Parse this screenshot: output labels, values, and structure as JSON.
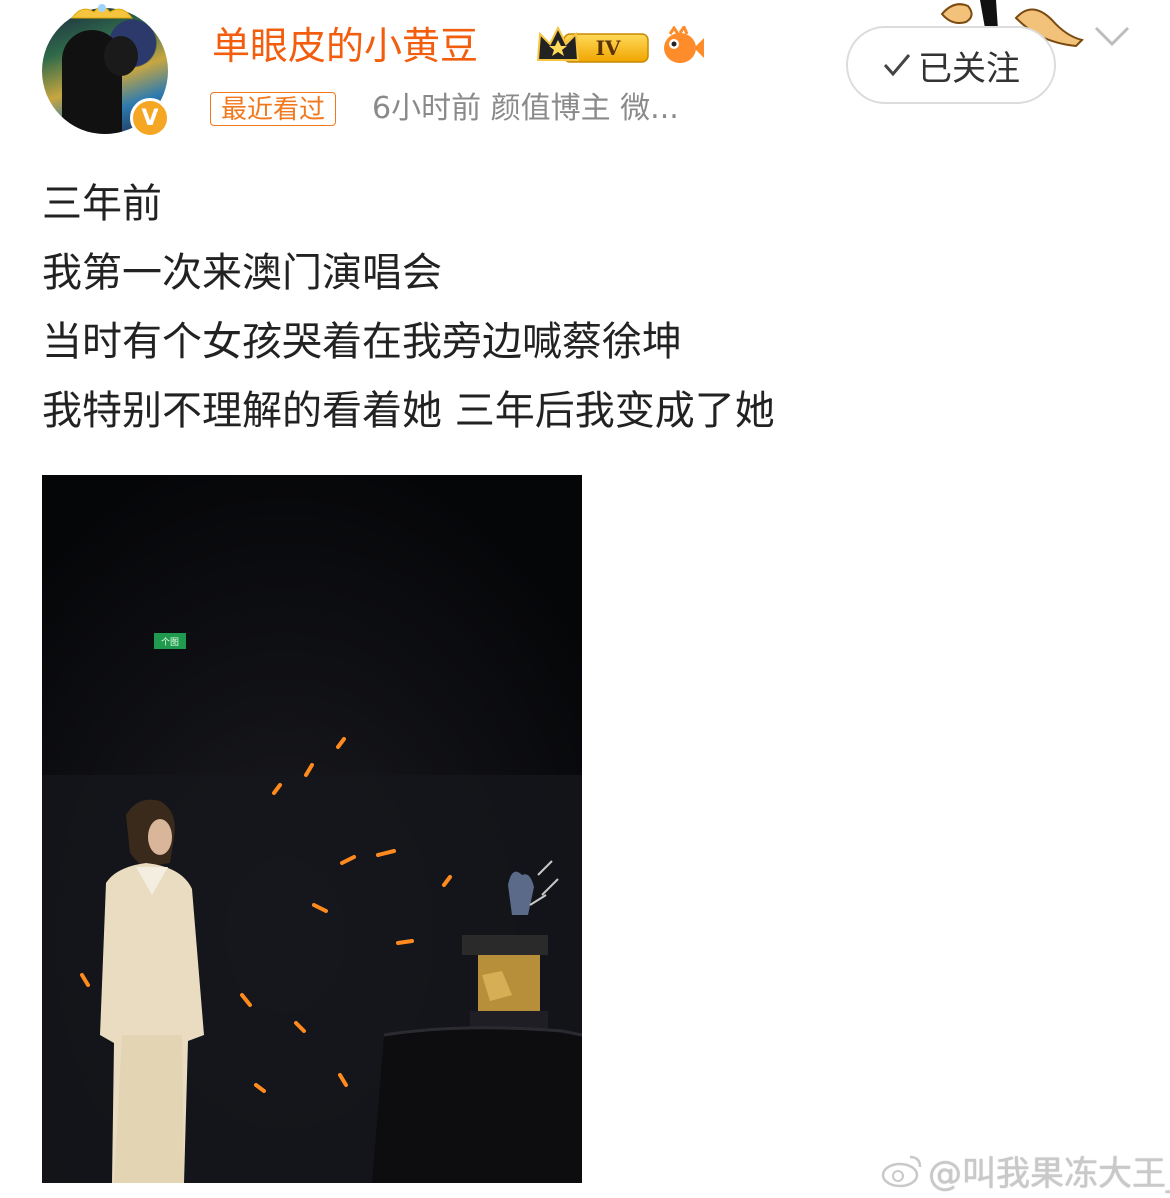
{
  "post": {
    "username": "单眼皮的小黄豆",
    "level_badge": "IV",
    "recent_tag": "最近看过",
    "meta": "6小时前  颜值博主 微...",
    "follow_label": "已关注",
    "text_lines": [
      "三年前",
      "我第一次来澳门演唱会",
      "当时有个女孩哭着在我旁边喊蔡徐坤",
      "我特别不理解的看着她 三年后我变成了她"
    ],
    "media": {
      "exit_sign": "个图"
    }
  },
  "watermark": "@叫我果冻大王_",
  "colors": {
    "username": "#f25d0e",
    "tag": "#f2781e",
    "meta": "#8a8a8a",
    "text": "#222222"
  },
  "icons": [
    "avatar",
    "verified-v-icon",
    "crown-level-icon",
    "fish-icon",
    "check-icon",
    "chevron-down-icon",
    "weibo-logo-icon"
  ]
}
